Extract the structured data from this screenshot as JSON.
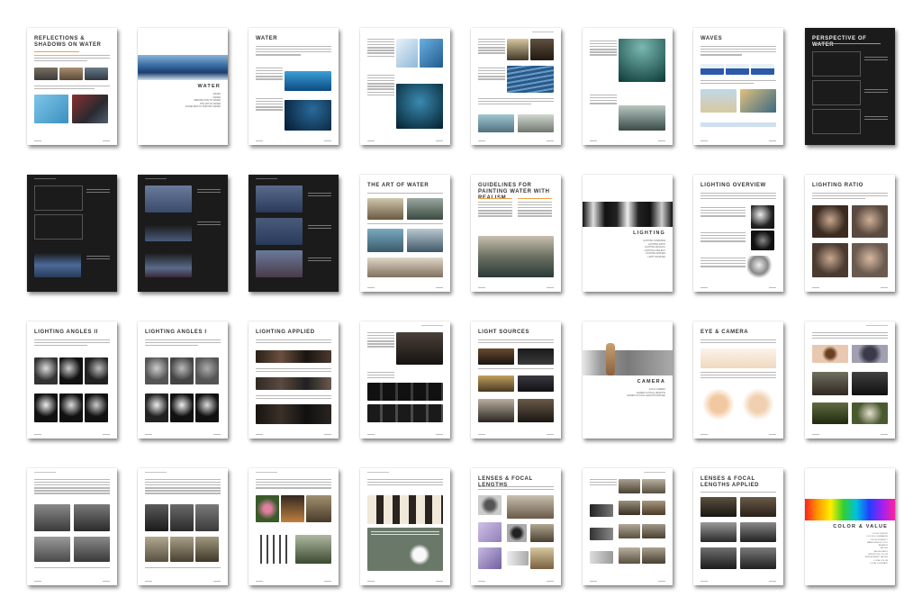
{
  "spread": {
    "rows": [
      [
        {
          "id": "p1",
          "title": "REFLECTIONS & SHADOWS ON WATER",
          "theme": "light"
        },
        {
          "id": "p2",
          "section": "WATER",
          "theme": "light",
          "toc": [
            "WAVES",
            "WATER",
            "PERSPECTIVE OF WATER",
            "THE ART OF WATER",
            "GUIDELINES TO PAINTING WATER"
          ]
        },
        {
          "id": "p3",
          "title": "WATER",
          "theme": "light"
        },
        {
          "id": "p4",
          "title": "",
          "theme": "light"
        },
        {
          "id": "p5",
          "title": "",
          "theme": "light"
        },
        {
          "id": "p6",
          "title": "",
          "theme": "light"
        },
        {
          "id": "p7",
          "title": "WAVES",
          "theme": "light"
        },
        {
          "id": "p8",
          "title": "PERSPECTIVE OF WATER",
          "theme": "dark"
        }
      ],
      [
        {
          "id": "p9",
          "title": "",
          "theme": "dark"
        },
        {
          "id": "p10",
          "title": "",
          "theme": "dark"
        },
        {
          "id": "p11",
          "title": "",
          "theme": "dark"
        },
        {
          "id": "p12",
          "title": "THE ART OF WATER",
          "theme": "light"
        },
        {
          "id": "p13",
          "title": "GUIDELINES FOR PAINTING WATER WITH REALISM",
          "theme": "light"
        },
        {
          "id": "p14",
          "section": "LIGHTING",
          "theme": "light",
          "toc": [
            "LIGHTING OVERVIEW",
            "LIGHTING RATIO",
            "LIGHTING ANGLES I",
            "LIGHTING ANGLES II",
            "LIGHTING APPLIED",
            "LIGHT SOURCES"
          ]
        },
        {
          "id": "p15",
          "title": "LIGHTING OVERVIEW",
          "theme": "light"
        },
        {
          "id": "p16",
          "title": "LIGHTING RATIO",
          "theme": "light"
        }
      ],
      [
        {
          "id": "p17",
          "title": "LIGHTING ANGLES II",
          "theme": "light"
        },
        {
          "id": "p18",
          "title": "LIGHTING ANGLES I",
          "theme": "light"
        },
        {
          "id": "p19",
          "title": "LIGHTING APPLIED",
          "theme": "light"
        },
        {
          "id": "p20",
          "title": "",
          "theme": "light"
        },
        {
          "id": "p21",
          "title": "LIGHT SOURCES",
          "theme": "light"
        },
        {
          "id": "p22",
          "section": "CAMERA",
          "theme": "light",
          "toc": [
            "EYE & CAMERA",
            "LENSES & FOCAL LENGTHS",
            "LENSES & FOCAL LENGTHS APPLIED"
          ]
        },
        {
          "id": "p23",
          "title": "EYE & CAMERA",
          "theme": "light"
        },
        {
          "id": "p24",
          "title": "",
          "theme": "light"
        }
      ],
      [
        {
          "id": "p25",
          "title": "",
          "theme": "light"
        },
        {
          "id": "p26",
          "title": "",
          "theme": "light"
        },
        {
          "id": "p27",
          "title": "",
          "theme": "light"
        },
        {
          "id": "p28",
          "title": "",
          "theme": "light"
        },
        {
          "id": "p29",
          "title": "LENSES & FOCAL LENGTHS",
          "theme": "light"
        },
        {
          "id": "p30",
          "title": "",
          "theme": "light"
        },
        {
          "id": "p31",
          "title": "LENSES & FOCAL LENGTHS APPLIED",
          "theme": "light"
        },
        {
          "id": "p32",
          "section": "COLOR & VALUE",
          "theme": "light",
          "toc": [
            "COLOR THEORY",
            "COLOR & LUMINANCE",
            "COLOR INTENSITY",
            "WARM VERSUS COOL",
            "BALANCE",
            "VALUES",
            "VALUES RATIO",
            "REFLECTED COLOR",
            "ATMOSPHERIC VALUES",
            "LOCAL COLOR",
            "LOCAL CONTRAST"
          ]
        }
      ]
    ]
  }
}
